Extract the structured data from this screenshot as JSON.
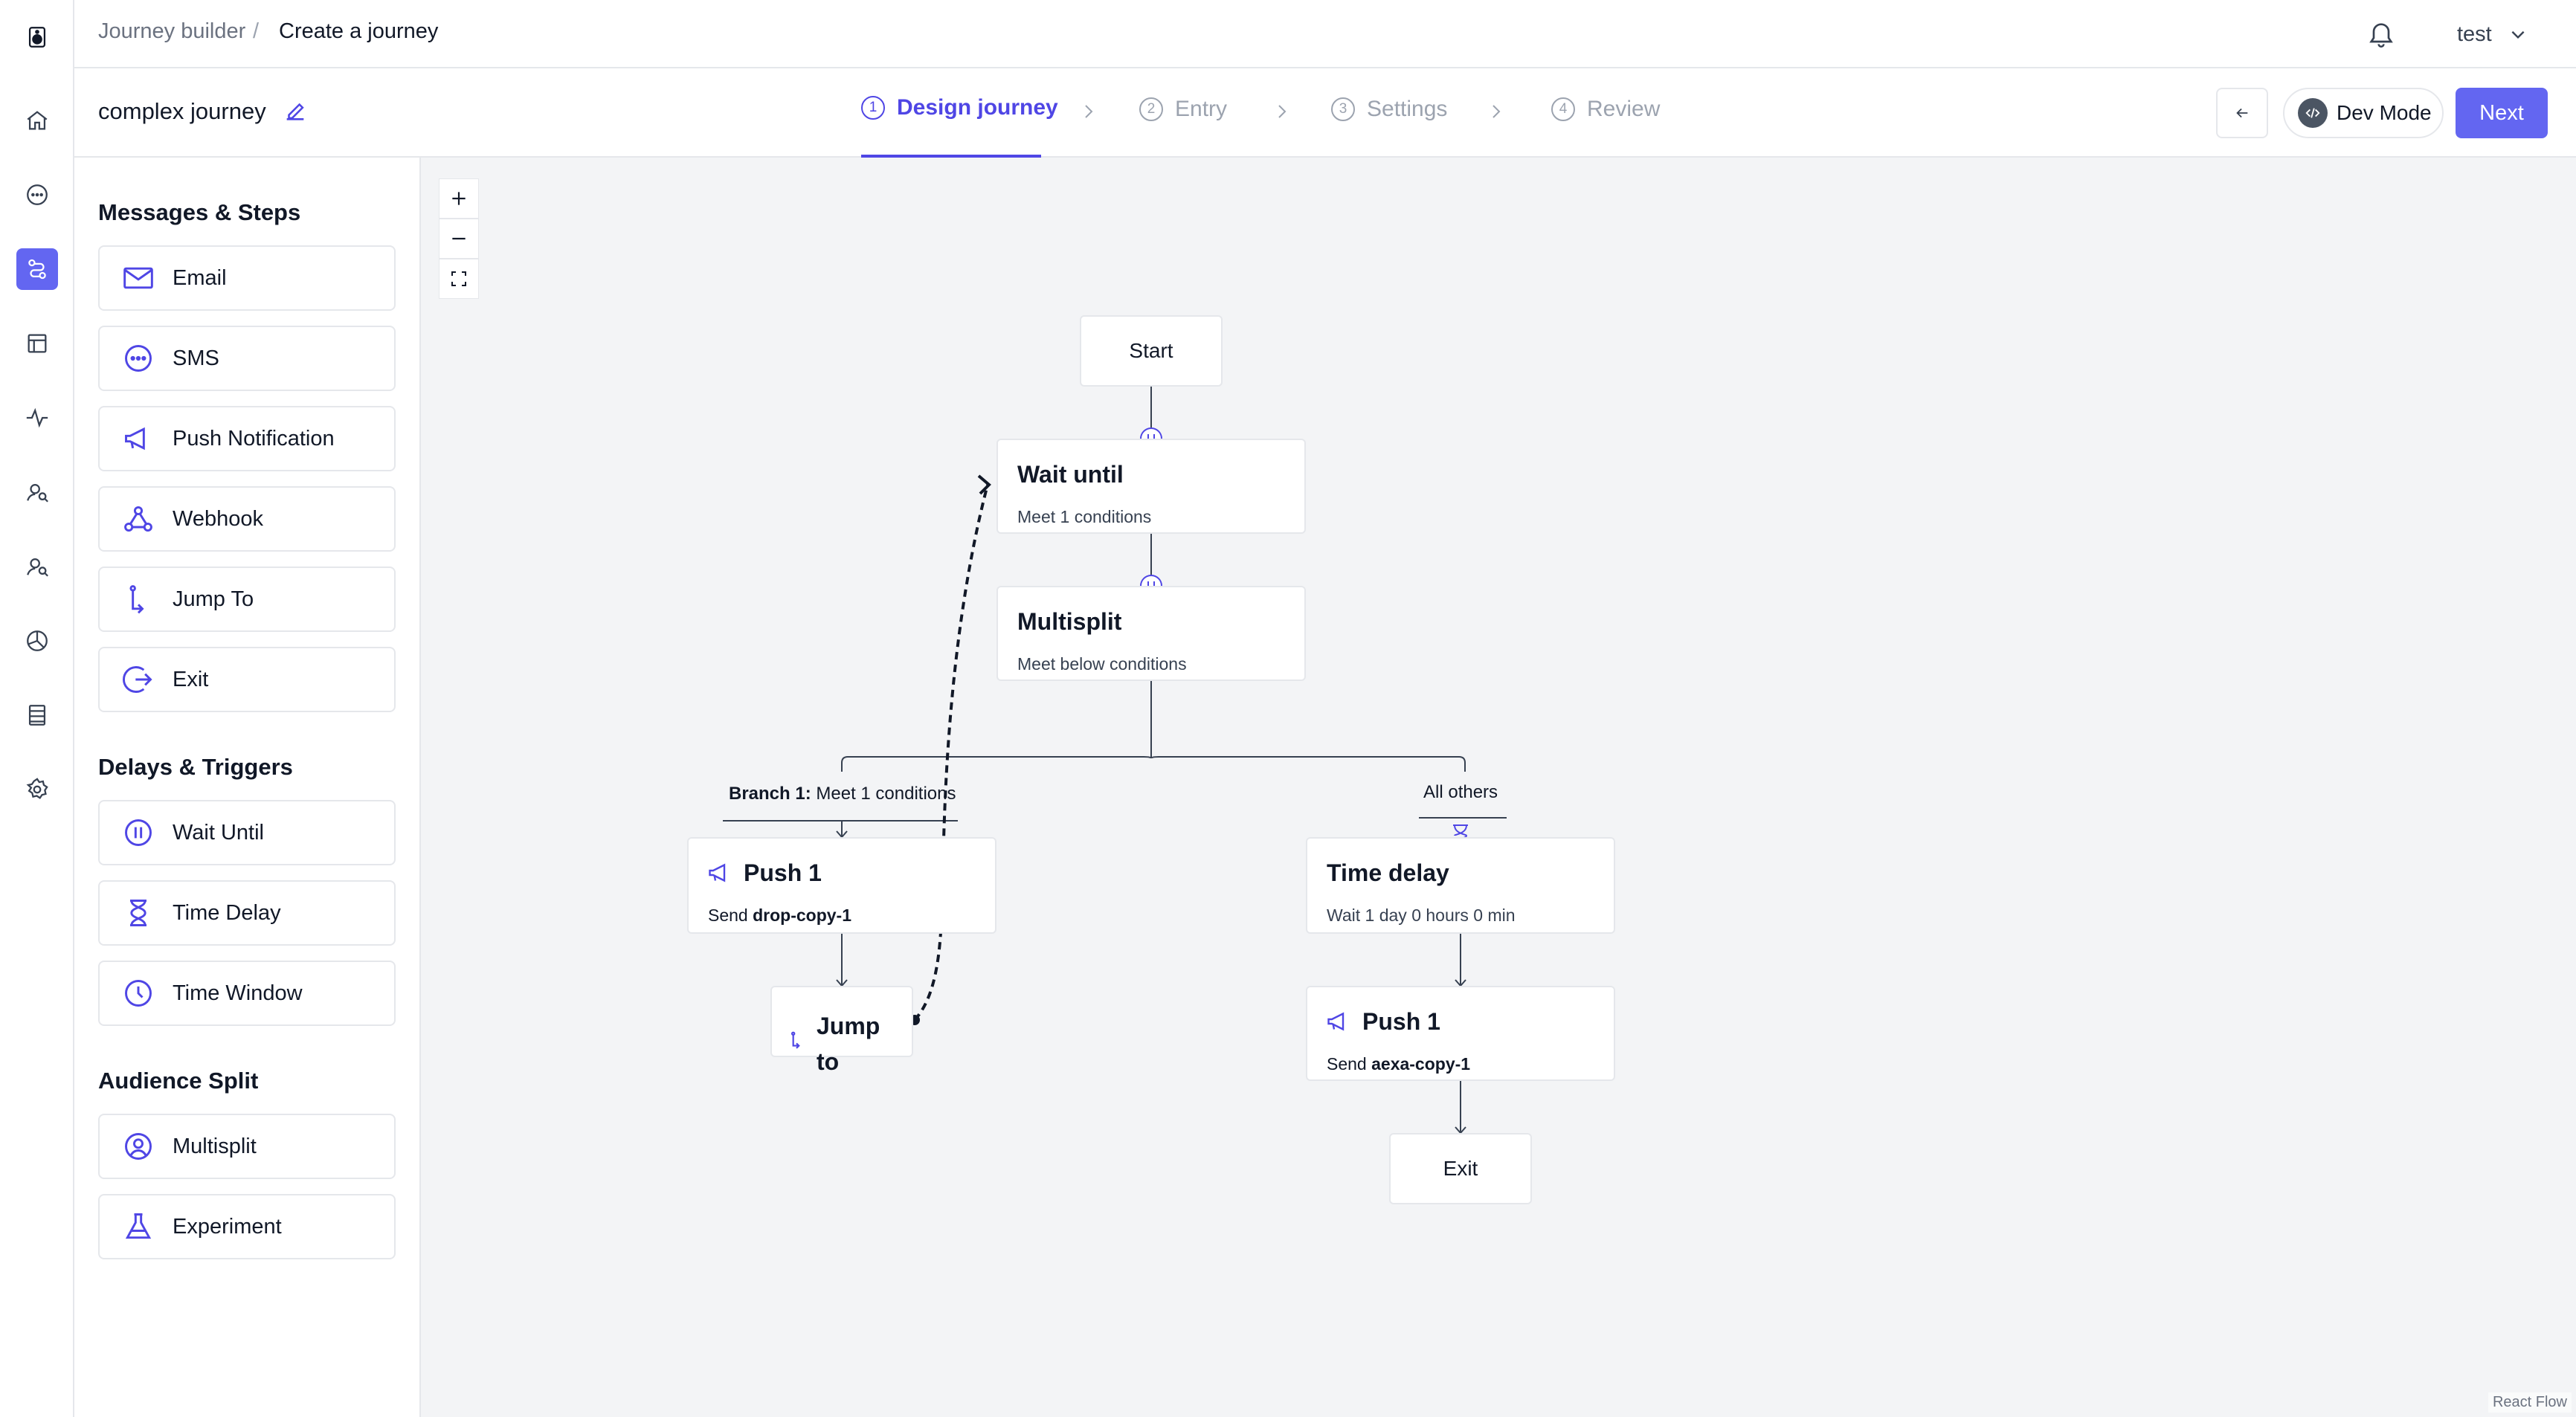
{
  "breadcrumb": {
    "root": "Journey builder",
    "separator": "/",
    "current": "Create a journey"
  },
  "user": {
    "name": "test"
  },
  "journey": {
    "name": "complex journey"
  },
  "steps": [
    {
      "num": "1",
      "label": "Design journey"
    },
    {
      "num": "2",
      "label": "Entry"
    },
    {
      "num": "3",
      "label": "Settings"
    },
    {
      "num": "4",
      "label": "Review"
    }
  ],
  "actions": {
    "dev_mode": "Dev Mode",
    "next": "Next"
  },
  "sidebar": {
    "sections": [
      {
        "title": "Messages & Steps",
        "items": [
          "Email",
          "SMS",
          "Push Notification",
          "Webhook",
          "Jump To",
          "Exit"
        ]
      },
      {
        "title": "Delays & Triggers",
        "items": [
          "Wait Until",
          "Time Delay",
          "Time Window"
        ]
      },
      {
        "title": "Audience Split",
        "items": [
          "Multisplit",
          "Experiment"
        ]
      }
    ]
  },
  "flow": {
    "start": "Start",
    "wait_until": {
      "title": "Wait until",
      "sub": "Meet 1 conditions"
    },
    "multisplit": {
      "title": "Multisplit",
      "sub": "Meet below conditions"
    },
    "branch1": {
      "label": "Branch 1:",
      "text": "Meet 1 conditions"
    },
    "all_others": "All others",
    "push_a": {
      "title": "Push 1",
      "sub_prefix": "Send ",
      "sub_value": "drop-copy-1"
    },
    "jump_to": {
      "line1": "Jump",
      "line2": "to"
    },
    "time_delay": {
      "title": "Time delay",
      "sub": "Wait 1 day 0 hours 0 min"
    },
    "push_b": {
      "title": "Push 1",
      "sub_prefix": "Send ",
      "sub_value": "aexa-copy-1"
    },
    "exit": "Exit"
  },
  "attribution": "React Flow",
  "colors": {
    "accent": "#4f46e5",
    "accent_button": "#6366f1",
    "canvas": "#f3f4f6"
  }
}
